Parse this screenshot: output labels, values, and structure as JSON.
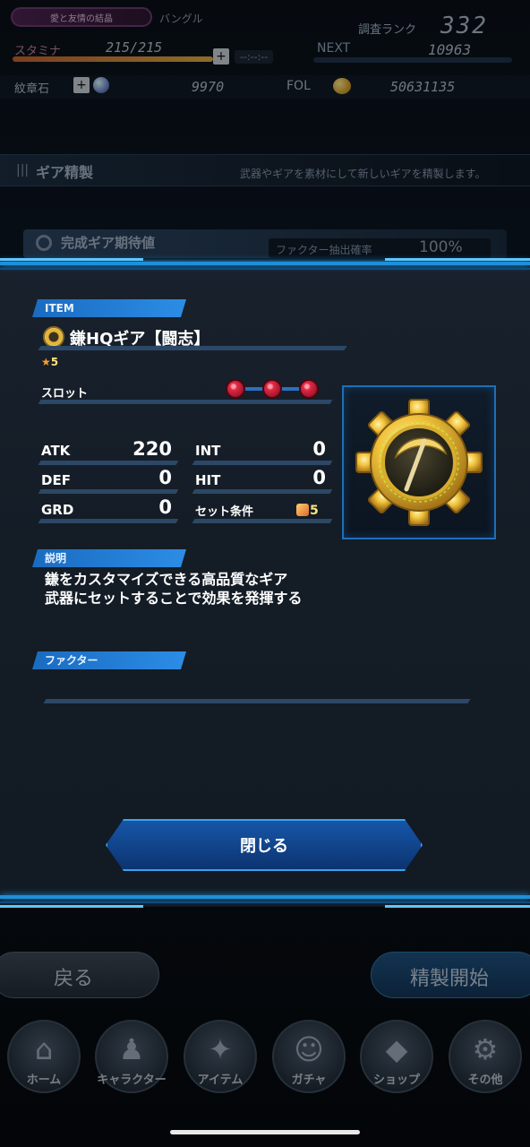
{
  "hud": {
    "event_label": "愛と友情の結晶",
    "equip_name": "バングル",
    "rank_label": "調査ランク",
    "rank_value": "332",
    "stamina_label": "スタミナ",
    "stamina_value": "215/215",
    "stamina_timer": "--:--:--",
    "next_label": "NEXT",
    "next_value": "10963",
    "emblem_label": "紋章石",
    "emblem_value": "9970",
    "fol_label": "FOL",
    "fol_value": "50631135"
  },
  "section": {
    "title": "ギア精製",
    "description": "武器やギアを素材にして新しいギアを精製します。"
  },
  "expected": {
    "title": "完成ギア期待値",
    "factor_label": "ファクター抽出確率",
    "factor_value": "100%"
  },
  "modal": {
    "item_tag": "ITEM",
    "item_name": "鎌HQギア【闘志】",
    "rarity": "5",
    "slot_label": "スロット",
    "slots_filled": 3,
    "stats": {
      "atk_label": "ATK",
      "atk_value": "220",
      "int_label": "INT",
      "int_value": "0",
      "def_label": "DEF",
      "def_value": "0",
      "hit_label": "HIT",
      "hit_value": "0",
      "grd_label": "GRD",
      "grd_value": "0",
      "set_label": "セット条件",
      "set_value": "5"
    },
    "desc_tag": "説明",
    "desc_line1": "鎌をカスタマイズできる高品質なギア",
    "desc_line2": "武器にセットすることで効果を発揮する",
    "factor_tag": "ファクター",
    "close_label": "閉じる"
  },
  "footer": {
    "back_label": "戻る",
    "refine_label": "精製開始"
  },
  "nav": [
    {
      "label": "ホーム",
      "icon": "home-icon"
    },
    {
      "label": "キャラクター",
      "icon": "character-icon"
    },
    {
      "label": "アイテム",
      "icon": "item-icon"
    },
    {
      "label": "ガチャ",
      "icon": "gacha-icon"
    },
    {
      "label": "ショップ",
      "icon": "shop-icon"
    },
    {
      "label": "その他",
      "icon": "settings-icon"
    }
  ],
  "colors": {
    "accent": "#1f8fd8",
    "tag_blue": "#2c8de6",
    "gem_red": "#e02a45",
    "gold": "#e2b53b"
  }
}
